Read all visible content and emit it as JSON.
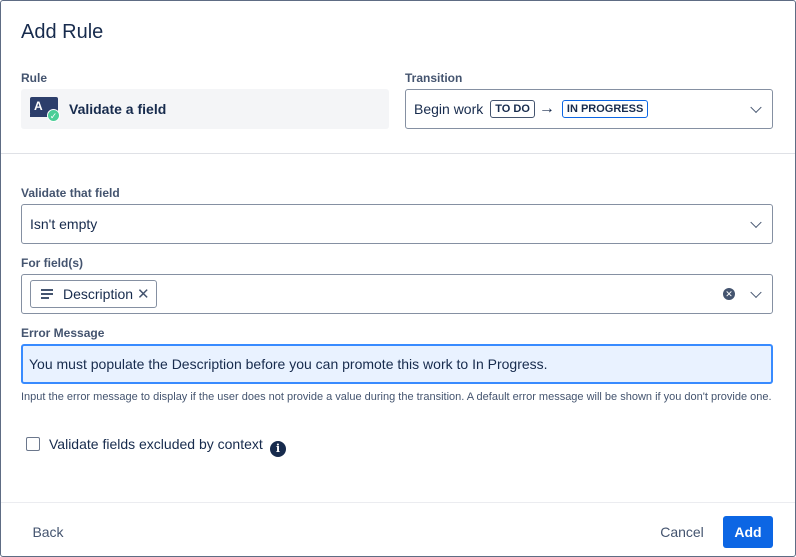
{
  "dialog": {
    "title": "Add Rule"
  },
  "rule": {
    "label": "Rule",
    "icon": "validate-field-icon",
    "name": "Validate a field"
  },
  "transition": {
    "label": "Transition",
    "name": "Begin work",
    "from": "TO DO",
    "to": "IN PROGRESS",
    "arrow": "→"
  },
  "validate_field": {
    "label": "Validate that field",
    "value": "Isn't empty"
  },
  "for_fields": {
    "label": "For field(s)",
    "tags": [
      {
        "label": "Description",
        "icon": "text-lines-icon"
      }
    ]
  },
  "error_message": {
    "label": "Error Message",
    "value": "You must populate the Description before you can promote this work to In Progress.",
    "help": "Input the error message to display if the user does not provide a value during the transition. A default error message will be shown if you don't provide one."
  },
  "excluded": {
    "label": "Validate fields excluded by context",
    "checked": false
  },
  "footer": {
    "back": "Back",
    "cancel": "Cancel",
    "add": "Add"
  },
  "colors": {
    "primary": "#0c66e4",
    "focus_border": "#388bff",
    "focus_bg": "#e9f2ff",
    "success": "#4bce97"
  }
}
